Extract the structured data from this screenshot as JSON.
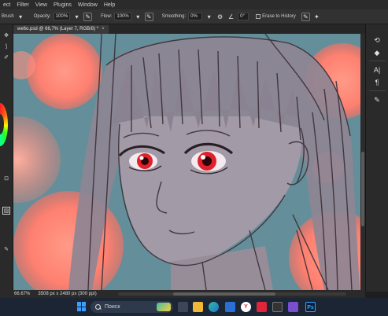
{
  "menubar": {
    "items": [
      "ect",
      "Filter",
      "View",
      "Plugins",
      "Window",
      "Help"
    ]
  },
  "options": {
    "tool": "Brush",
    "opacity_label": "Opacity:",
    "opacity_value": "100%",
    "flow_label": "Flow:",
    "flow_value": "100%",
    "smoothing_label": "Smoothing:",
    "smoothing_value": "0%",
    "angle_value": "0°",
    "erase_to_history": "Erase to History"
  },
  "document": {
    "tab_title": "we6o.psd @ 66,7% (Layer 7, RGB/8) *",
    "close_glyph": "×"
  },
  "status": {
    "zoom": "66.67%",
    "doc_info": "3508 px x 2480 px (300 ppi)"
  },
  "taskbar": {
    "search_placeholder": "Поиск",
    "apps": [
      "file-explorer",
      "edge",
      "mail",
      "yandex",
      "app-red",
      "photoshop"
    ],
    "ps_label": "Ps",
    "yandex_label": "Y"
  },
  "colors": {
    "canvas_bg": "#5e8a96",
    "bokeh": "#ff8a78",
    "skin": "#9c8f99",
    "eye_red": "#e0202a",
    "taskbar": "#1c2533",
    "accent_blue": "#3aa0ff"
  }
}
